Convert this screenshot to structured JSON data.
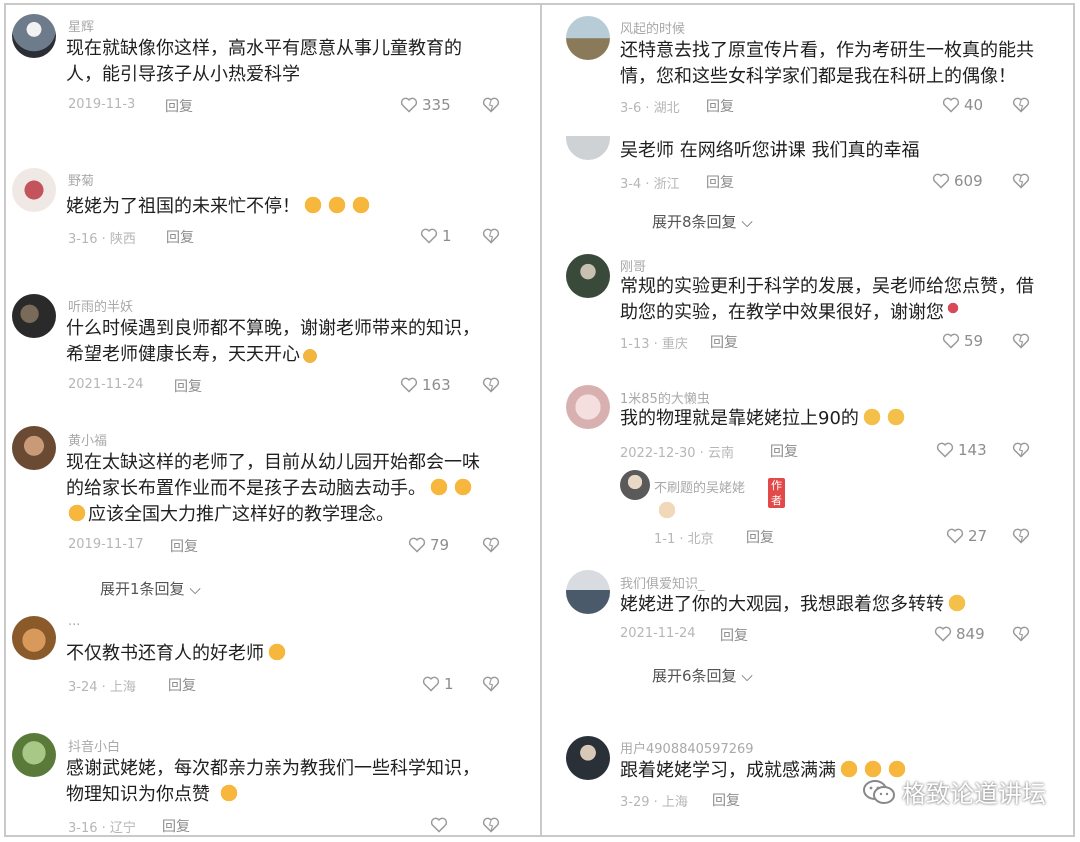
{
  "left_column": [
    {
      "username": "星辉",
      "lines": [
        "现在就缺像你这样，高水平有愿意从事儿童教育的",
        "人，能引导孩子从小热爱科学"
      ],
      "date": "2019-11-3",
      "reply": "回复",
      "likes": "335",
      "avatar_color": "#6e7b8a"
    },
    {
      "username": "野菊",
      "lines": [
        "姥姥为了祖国的未来忙不停！"
      ],
      "emoji_count": 3,
      "date": "3-16 · 陕西",
      "reply": "回复",
      "likes": "1",
      "avatar_color": "#c4545c"
    },
    {
      "username": "听雨的半妖",
      "lines": [
        "什么时候遇到良师都不算晚，谢谢老师带来的知识，",
        "希望老师健康长寿，天天开心"
      ],
      "date": "2021-11-24",
      "reply": "回复",
      "likes": "163",
      "avatar_color": "#3a3a3a"
    },
    {
      "username": "黄小福",
      "lines": [
        "现在太缺这样的老师了，目前从幼儿园开始都会一味",
        "的给家长布置作业而不是孩子去动脑去动手。",
        "应该全国大力推广这样好的教学理念。"
      ],
      "date": "2019-11-17",
      "reply": "回复",
      "likes": "79",
      "avatar_color": "#8a5a3c",
      "expand": "展开1条回复"
    },
    {
      "username": "···",
      "lines": [
        "不仅教书还育人的好老师"
      ],
      "date": "3-24 · 上海",
      "reply": "回复",
      "likes": "1",
      "avatar_color": "#b07a3c"
    },
    {
      "username": "抖音小白",
      "lines": [
        "感谢武姥姥，每次都亲力亲为教我们一些科学知识，",
        "物理知识为你点赞"
      ],
      "date": "3-16 · 辽宁",
      "reply": "回复",
      "likes": "",
      "avatar_color": "#7aa35a"
    }
  ],
  "right_column": [
    {
      "username": "风起的时候",
      "lines": [
        "还特意去找了原宣传片看，作为考研生一枚真的能共",
        "情，您和这些女科学家们都是我在科研上的偶像！"
      ],
      "date": "3-6 · 湖北",
      "reply": "回复",
      "likes": "40",
      "avatar_color": "#8aa0b0"
    },
    {
      "username": "",
      "lines": [
        "吴老师 在网络听您讲课 我们真的幸福"
      ],
      "date": "3-4 · 浙江",
      "reply": "回复",
      "likes": "609",
      "avatar_color": "#c8c8c8",
      "expand": "展开8条回复"
    },
    {
      "username": "刚哥",
      "lines": [
        "常规的实验更利于科学的发展，吴老师给您点赞，借",
        "助您的实验，在教学中效果很好，谢谢您"
      ],
      "date": "1-13 · 重庆",
      "reply": "回复",
      "likes": "59",
      "avatar_color": "#4a5a4a"
    },
    {
      "username": "1米85的大懒虫",
      "lines": [
        "我的物理就是靠姥姥拉上90的"
      ],
      "date": "2022-12-30 · 云南",
      "reply": "回复",
      "likes": "143",
      "avatar_color": "#e8c8c8",
      "sub_reply": {
        "username": "不刷题的吴姥姥",
        "tag": "作者",
        "date": "1-1 · 北京",
        "reply": "回复",
        "likes": "27"
      }
    },
    {
      "username": "我们俱爱知识_",
      "lines": [
        "姥姥进了你的大观园，我想跟着您多转转"
      ],
      "date": "2021-11-24",
      "reply": "回复",
      "likes": "849",
      "avatar_color": "#5a6a7a",
      "expand": "展开6条回复"
    },
    {
      "username": "用户4908840597269",
      "lines": [
        "跟着姥姥学习，成就感满满"
      ],
      "date": "3-29 · 上海",
      "reply": "回复",
      "likes": "",
      "avatar_color": "#3a4048"
    }
  ],
  "watermark": "格致论道讲坛",
  "colors": {
    "meta": "#b6b6b6",
    "text": "#1f1f1f",
    "author_tag": "#e24a4a"
  }
}
